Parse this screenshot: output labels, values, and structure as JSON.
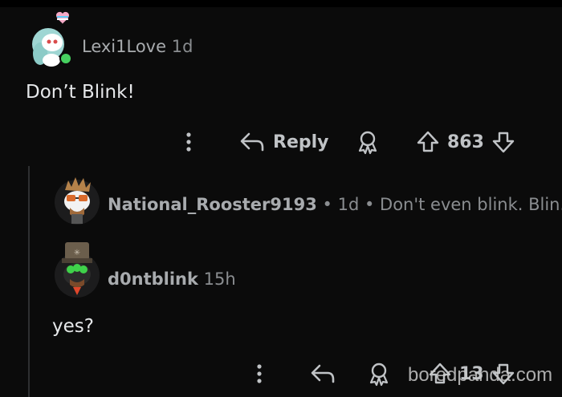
{
  "comments": [
    {
      "username": "Lexi1Love",
      "age": "1d",
      "body": "Don’t Blink!",
      "reply_label": "Reply",
      "votes": "863"
    },
    {
      "username": "National_Rooster9193",
      "meta": "• 1d • Don't even blink. Blin..."
    },
    {
      "username": "d0ntblink",
      "age": "15h",
      "body": "yes?",
      "votes": "13"
    }
  ],
  "watermark": "boredpanda.com",
  "colors": {
    "background": "#0b0b0b",
    "text": "#d7dadc",
    "muted": "#a8abae",
    "online": "#46d160"
  },
  "icons": [
    "more-icon",
    "reply-icon",
    "award-icon",
    "upvote-icon",
    "downvote-icon"
  ]
}
